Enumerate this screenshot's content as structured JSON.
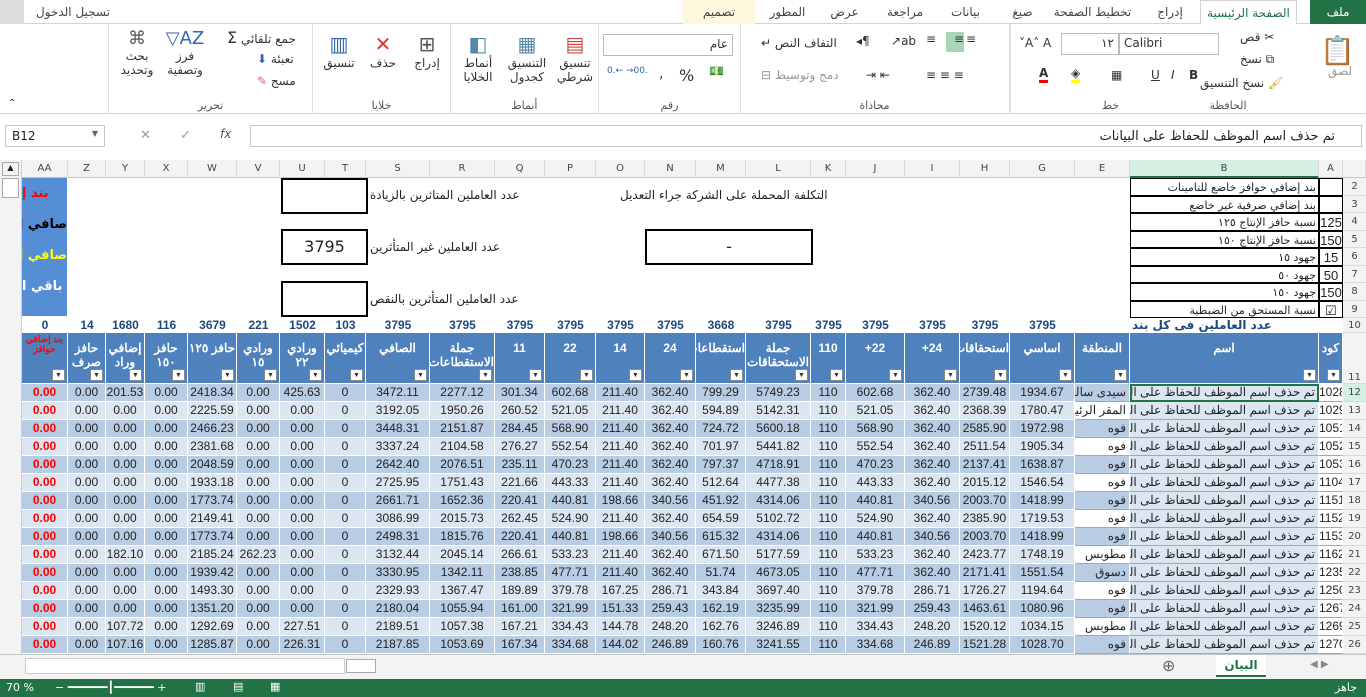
{
  "window": {
    "sign_in": "تسجيل الدخول"
  },
  "tabs": [
    "ملف",
    "الصفحة الرئيسية",
    "إدراج",
    "تخطيط الصفحة",
    "صيغ",
    "بيانات",
    "مراجعة",
    "عرض",
    "المطور",
    "تصميم"
  ],
  "ribbon": {
    "clipboard": {
      "label": "الحافظة",
      "paste": "لصق",
      "cut": "قص",
      "copy": "نسخ",
      "format_painter": "نسخ التنسيق"
    },
    "font": {
      "label": "خط",
      "name": "Calibri",
      "size": "١٢",
      "bold": "B",
      "italic": "I",
      "underline": "U"
    },
    "alignment": {
      "label": "محاذاة",
      "wrap": "التفاف النص",
      "merge": "دمج وتوسيط"
    },
    "number": {
      "label": "رقم",
      "format": "عام",
      "percent": "%",
      "comma": ","
    },
    "styles": {
      "label": "أنماط",
      "conditional": "تنسيق شرطي",
      "table": "التنسيق كجدول",
      "cell_styles": "أنماط الخلايا"
    },
    "cells": {
      "label": "خلايا",
      "insert": "إدراج",
      "delete": "حذف",
      "format": "تنسيق"
    },
    "editing": {
      "label": "تحرير",
      "autosum": "جمع تلقائي",
      "fill": "تعبئة",
      "clear": "مسح",
      "sort": "فرز وتصفية",
      "find": "بحث وتحديد"
    }
  },
  "formula_bar": {
    "name_box": "B12",
    "fx": "fx",
    "content": "تم حذف اسم الموظف للحفاظ على البيانات"
  },
  "col_letters": [
    "AA",
    "Z",
    "Y",
    "X",
    "W",
    "V",
    "U",
    "T",
    "S",
    "R",
    "Q",
    "P",
    "O",
    "N",
    "M",
    "L",
    "K",
    "J",
    "I",
    "H",
    "G",
    "E",
    "B",
    "A"
  ],
  "top_panel": {
    "items": [
      [
        "بند إضافي حوافز خاضع للتامينات",
        ""
      ],
      [
        "بند إضافي صرفية غير خاضع",
        ""
      ],
      [
        "نسبة حافز الإنتاج ١٢٥",
        "125"
      ],
      [
        "نسبة حافز الإنتاج ١٥٠",
        "150"
      ],
      [
        "جهود ١٥",
        "15"
      ],
      [
        "جهود ٥٠",
        "50"
      ],
      [
        "جهود ١٥٠",
        "150"
      ],
      [
        "نسبة المستحق من الضبطية",
        "☑"
      ]
    ],
    "cost_label": "التكلفة المحملة على الشركة جراء التعديل",
    "cost_value": "-",
    "increase_label": "عدد العاملين المتاثرين بالزيادة",
    "increase_value": "",
    "unaffected_label": "عدد العاملين غير المتأثرين",
    "unaffected_value": "3795",
    "decrease_label": "عدد العاملين المتأثرين بالنقص",
    "decrease_value": "",
    "blue_box": [
      "بند إ",
      "صافي ال",
      "صافي ال",
      "باقي ا"
    ],
    "counts_label": "عدد العاملين فى كل بند"
  },
  "counts": [
    "",
    "",
    "",
    "3795",
    "3795",
    "3795",
    "3795",
    "3795",
    "3795",
    "3668",
    "3795",
    "3795",
    "3795",
    "3795",
    "3795",
    "3795",
    "103",
    "1502",
    "221",
    "3679",
    "116",
    "1680",
    "14",
    "0"
  ],
  "headers": [
    "كود",
    "اسم",
    "المنطقة",
    "اساسي",
    "استحقاقات",
    "24+",
    "22+",
    "110",
    "جملة الاستحقاقات",
    "استقطاعات",
    "24",
    "14",
    "22",
    "11",
    "جملة الاستقطاعات",
    "الصافي",
    "كيميائي",
    "ورادي ٢٢",
    "ورادي ١٥",
    "حافز ١٢٥",
    "حافز ١٥٠",
    "إضافي وراد",
    "حافز صرف",
    "بند إضافي حوافز"
  ],
  "row_numbers": [
    12,
    13,
    14,
    15,
    16,
    17,
    18,
    19,
    20,
    21,
    22,
    23,
    24,
    25,
    26
  ],
  "rows": [
    [
      "1028",
      "تم حذف اسم الموظف للحفاظ على البيانات",
      "سيدى سالم",
      "1934.67",
      "2739.48",
      "362.40",
      "602.68",
      "110",
      "5749.23",
      "799.29",
      "362.40",
      "211.40",
      "602.68",
      "301.34",
      "2277.12",
      "3472.11",
      "0",
      "425.63",
      "0.00",
      "2418.34",
      "0.00",
      "201.53",
      "0.00",
      "0.00"
    ],
    [
      "1029",
      "تم حذف اسم الموظف للحفاظ على البيانات",
      "المقر الرئيسى",
      "1780.47",
      "2368.39",
      "362.40",
      "521.05",
      "110",
      "5142.31",
      "594.89",
      "362.40",
      "211.40",
      "521.05",
      "260.52",
      "1950.26",
      "3192.05",
      "0",
      "0.00",
      "0.00",
      "2225.59",
      "0.00",
      "0.00",
      "0.00",
      "0.00"
    ],
    [
      "1051",
      "تم حذف اسم الموظف للحفاظ على البيانات",
      "فوه",
      "1972.98",
      "2585.90",
      "362.40",
      "568.90",
      "110",
      "5600.18",
      "724.72",
      "362.40",
      "211.40",
      "568.90",
      "284.45",
      "2151.87",
      "3448.31",
      "0",
      "0.00",
      "0.00",
      "2466.23",
      "0.00",
      "0.00",
      "0.00",
      "0.00"
    ],
    [
      "1052",
      "تم حذف اسم الموظف للحفاظ على البيانات",
      "فوه",
      "1905.34",
      "2511.54",
      "362.40",
      "552.54",
      "110",
      "5441.82",
      "701.97",
      "362.40",
      "211.40",
      "552.54",
      "276.27",
      "2104.58",
      "3337.24",
      "0",
      "0.00",
      "0.00",
      "2381.68",
      "0.00",
      "0.00",
      "0.00",
      "0.00"
    ],
    [
      "1053",
      "تم حذف اسم الموظف للحفاظ على البيانات",
      "فوه",
      "1638.87",
      "2137.41",
      "362.40",
      "470.23",
      "110",
      "4718.91",
      "797.37",
      "362.40",
      "211.40",
      "470.23",
      "235.11",
      "2076.51",
      "2642.40",
      "0",
      "0.00",
      "0.00",
      "2048.59",
      "0.00",
      "0.00",
      "0.00",
      "0.00"
    ],
    [
      "1104",
      "تم حذف اسم الموظف للحفاظ على البيانات",
      "فوه",
      "1546.54",
      "2015.12",
      "362.40",
      "443.33",
      "110",
      "4477.38",
      "512.64",
      "362.40",
      "211.40",
      "443.33",
      "221.66",
      "1751.43",
      "2725.95",
      "0",
      "0.00",
      "0.00",
      "1933.18",
      "0.00",
      "0.00",
      "0.00",
      "0.00"
    ],
    [
      "1151",
      "تم حذف اسم الموظف للحفاظ على البيانات",
      "فوه",
      "1418.99",
      "2003.70",
      "340.56",
      "440.81",
      "110",
      "4314.06",
      "451.92",
      "340.56",
      "198.66",
      "440.81",
      "220.41",
      "1652.36",
      "2661.71",
      "0",
      "0.00",
      "0.00",
      "1773.74",
      "0.00",
      "0.00",
      "0.00",
      "0.00"
    ],
    [
      "1152",
      "تم حذف اسم الموظف للحفاظ على البيانات",
      "فوه",
      "1719.53",
      "2385.90",
      "362.40",
      "524.90",
      "110",
      "5102.72",
      "654.59",
      "362.40",
      "211.40",
      "524.90",
      "262.45",
      "2015.73",
      "3086.99",
      "0",
      "0.00",
      "0.00",
      "2149.41",
      "0.00",
      "0.00",
      "0.00",
      "0.00"
    ],
    [
      "1153",
      "تم حذف اسم الموظف للحفاظ على البيانات",
      "فوه",
      "1418.99",
      "2003.70",
      "340.56",
      "440.81",
      "110",
      "4314.06",
      "615.32",
      "340.56",
      "198.66",
      "440.81",
      "220.41",
      "1815.76",
      "2498.31",
      "0",
      "0.00",
      "0.00",
      "1773.74",
      "0.00",
      "0.00",
      "0.00",
      "0.00"
    ],
    [
      "1162",
      "تم حذف اسم الموظف للحفاظ على البيانات",
      "مطوبس",
      "1748.19",
      "2423.77",
      "362.40",
      "533.23",
      "110",
      "5177.59",
      "671.50",
      "362.40",
      "211.40",
      "533.23",
      "266.61",
      "2045.14",
      "3132.44",
      "0",
      "0.00",
      "262.23",
      "2185.24",
      "0.00",
      "182.10",
      "0.00",
      "0.00"
    ],
    [
      "1235",
      "تم حذف اسم الموظف للحفاظ على البيانات",
      "دسوق",
      "1551.54",
      "2171.41",
      "362.40",
      "477.71",
      "110",
      "4673.05",
      "51.74",
      "362.40",
      "211.40",
      "477.71",
      "238.85",
      "1342.11",
      "3330.95",
      "0",
      "0.00",
      "0.00",
      "1939.42",
      "0.00",
      "0.00",
      "0.00",
      "0.00"
    ],
    [
      "1250",
      "تم حذف اسم الموظف للحفاظ على البيانات",
      "فوه",
      "1194.64",
      "1726.27",
      "286.71",
      "379.78",
      "110",
      "3697.40",
      "343.84",
      "286.71",
      "167.25",
      "379.78",
      "189.89",
      "1367.47",
      "2329.93",
      "0",
      "0.00",
      "0.00",
      "1493.30",
      "0.00",
      "0.00",
      "0.00",
      "0.00"
    ],
    [
      "1267",
      "تم حذف اسم الموظف للحفاظ على البيانات",
      "فوه",
      "1080.96",
      "1463.61",
      "259.43",
      "321.99",
      "110",
      "3235.99",
      "162.19",
      "259.43",
      "151.33",
      "321.99",
      "161.00",
      "1055.94",
      "2180.04",
      "0",
      "0.00",
      "0.00",
      "1351.20",
      "0.00",
      "0.00",
      "0.00",
      "0.00"
    ],
    [
      "1269",
      "تم حذف اسم الموظف للحفاظ على البيانات",
      "مطوبس",
      "1034.15",
      "1520.12",
      "248.20",
      "334.43",
      "110",
      "3246.89",
      "162.76",
      "248.20",
      "144.78",
      "334.43",
      "167.21",
      "1057.38",
      "2189.51",
      "0",
      "227.51",
      "0.00",
      "1292.69",
      "0.00",
      "107.72",
      "0.00",
      "0.00"
    ],
    [
      "1270",
      "تم حذف اسم الموظف للحفاظ على البيانات",
      "فوه",
      "1028.70",
      "1521.28",
      "246.89",
      "334.68",
      "110",
      "3241.55",
      "160.76",
      "246.89",
      "144.02",
      "334.68",
      "167.34",
      "1053.69",
      "2187.85",
      "0",
      "226.31",
      "0.00",
      "1285.87",
      "0.00",
      "107.16",
      "0.00",
      "0.00"
    ]
  ],
  "sheet_tab": "البيان",
  "status": {
    "ready": "جاهز",
    "zoom": "70 %"
  },
  "colors": {
    "accent": "#217346",
    "header_blue": "#4f81bd",
    "row_dark": "#b8cce4",
    "row_light": "#dce6f1",
    "red": "#ff0000"
  }
}
